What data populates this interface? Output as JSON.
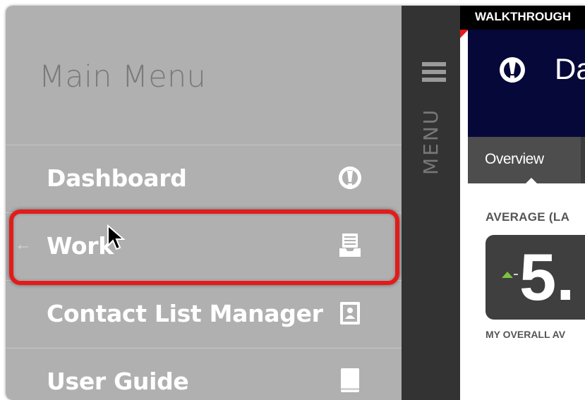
{
  "menu": {
    "title": "Main Menu",
    "items": [
      {
        "label": "Dashboard",
        "icon": "dashboard-gauge-icon"
      },
      {
        "label": "Work",
        "icon": "inbox-tray-icon",
        "highlighted": true
      },
      {
        "label": "Contact List Manager",
        "icon": "contact-card-icon"
      },
      {
        "label": "User Guide",
        "icon": "book-icon"
      }
    ],
    "back_arrow": "←"
  },
  "strip": {
    "menu_label": "MENU"
  },
  "app": {
    "walkthrough_label": "WALKTHROUGH",
    "header_title": "Da",
    "tabs": [
      {
        "label": "Overview"
      }
    ],
    "average_label": "AVERAGE (LA",
    "score": "5.",
    "overall_label": "MY OVERALL AV"
  },
  "colors": {
    "menu_bg": "#b0b0b0",
    "strip_bg": "#333333",
    "header_bg": "#06083a",
    "highlight": "#e31b1b",
    "trend_up": "#7cc242"
  }
}
